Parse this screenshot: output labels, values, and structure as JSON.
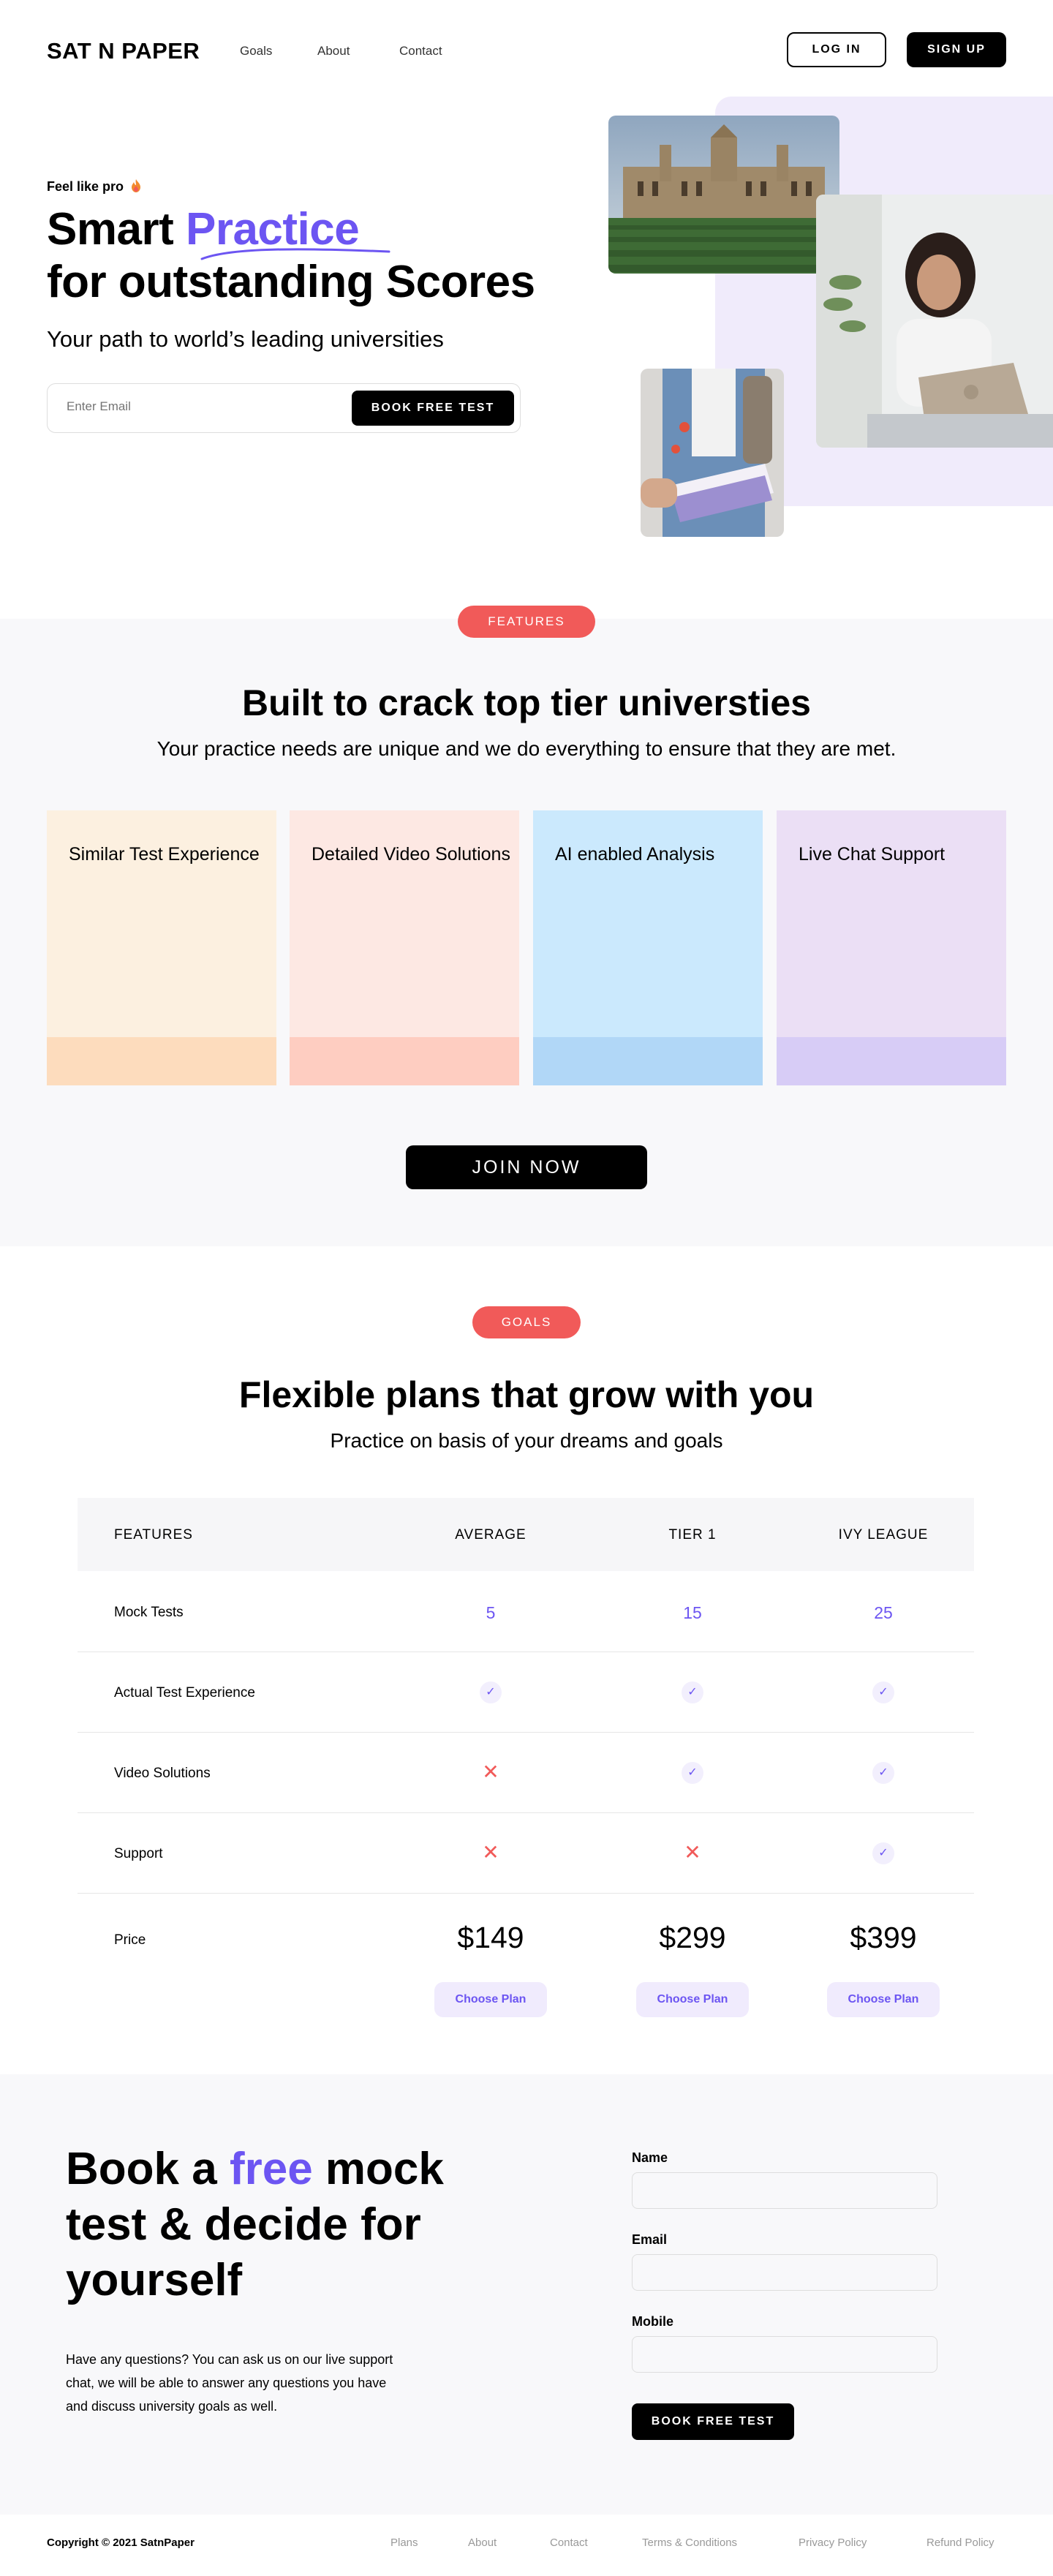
{
  "header": {
    "logo": "SAT N PAPER",
    "nav": [
      "Goals",
      "About",
      "Contact"
    ],
    "login_label": "LOG IN",
    "signup_label": "SIGN UP"
  },
  "hero": {
    "eyebrow": "Feel like pro",
    "eyebrow_icon": "fire-icon",
    "title_pre": "Smart ",
    "title_accent": "Practice",
    "title_line2": "for outstanding Scores",
    "subtitle": "Your path to world’s leading universities",
    "email_placeholder": "Enter Email",
    "cta_label": "BOOK FREE TEST",
    "accent_color": "#6c55f2"
  },
  "features": {
    "pill": "FEATURES",
    "title": "Built to crack top tier universties",
    "subtitle": "Your practice needs are unique and we do everything to ensure that they are met.",
    "cards": [
      {
        "label": "Similar Test Experience",
        "bg": "#fcf0e0",
        "foot": "#fddcbd"
      },
      {
        "label": "Detailed Video Solutions",
        "bg": "#fde8e3",
        "foot": "#fecdc1"
      },
      {
        "label": "AI enabled Analysis",
        "bg": "#cbe9fd",
        "foot": "#b1d7f7"
      },
      {
        "label": "Live Chat Support",
        "bg": "#ebdff5",
        "foot": "#d7ccf6"
      }
    ],
    "join_label": "JOIN NOW"
  },
  "goals": {
    "pill": "GOALS",
    "title": "Flexible plans that grow with you",
    "subtitle": "Practice on basis of your dreams and goals",
    "columns": [
      "FEATURES",
      "AVERAGE",
      "TIER 1",
      "IVY LEAGUE"
    ],
    "rows": [
      {
        "label": "Mock Tests",
        "values": [
          "5",
          "15",
          "25"
        ]
      },
      {
        "label": "Actual Test Experience",
        "values": [
          "check",
          "check",
          "check"
        ]
      },
      {
        "label": "Video Solutions",
        "values": [
          "cross",
          "check",
          "check"
        ]
      },
      {
        "label": "Support",
        "values": [
          "cross",
          "cross",
          "check"
        ]
      }
    ],
    "price_label": "Price",
    "prices": [
      "$149",
      "$299",
      "$399"
    ],
    "choose_label": "Choose Plan"
  },
  "booking": {
    "title_pre": "Book a ",
    "title_accent": "free",
    "title_post": " mock test & decide for yourself",
    "text": "Have any questions? You can ask us on our live support chat, we will be able to answer any questions you have and discuss university goals as well.",
    "fields": [
      "Name",
      "Email",
      "Mobile"
    ],
    "cta_label": "BOOK FREE TEST"
  },
  "footer": {
    "copyright": "Copyright © 2021 SatnPaper",
    "links": [
      "Plans",
      "About",
      "Contact",
      "Terms & Conditions",
      "Privacy Policy",
      "Refund Policy"
    ]
  }
}
